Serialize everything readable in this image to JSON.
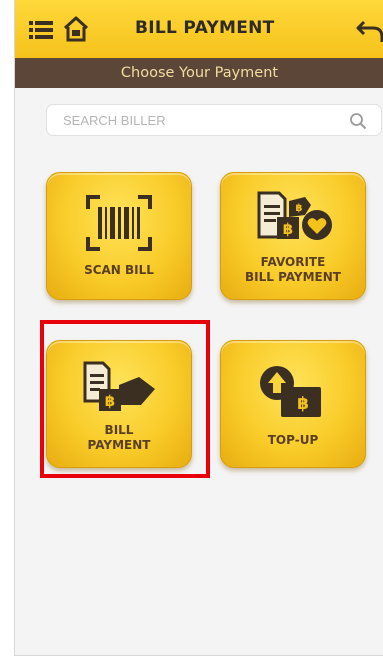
{
  "header": {
    "title": "BILL PAYMENT",
    "menu_icon": "menu-icon",
    "home_icon": "home-icon",
    "back_icon": "back-arrow-icon",
    "bg_color": "#f8c91f"
  },
  "subheader": {
    "text": "Choose Your Payment",
    "bg_color": "#5b4638",
    "text_color": "#f3dca0"
  },
  "search": {
    "placeholder": "SEARCH BILLER",
    "icon": "search-icon"
  },
  "tiles": [
    {
      "id": "scan-bill",
      "label": "SCAN BILL",
      "icon": "barcode-scan-icon"
    },
    {
      "id": "favorite-bill-payment",
      "label_line1": "FAVORITE",
      "label_line2": "BILL PAYMENT",
      "icon": "favorite-bill-icon"
    },
    {
      "id": "bill-payment",
      "label_line1": "BILL",
      "label_line2": "PAYMENT",
      "icon": "bill-payment-icon",
      "highlighted": true
    },
    {
      "id": "top-up",
      "label": "TOP-UP",
      "icon": "top-up-icon"
    }
  ],
  "colors": {
    "tile_yellow": "#f9cc2a",
    "highlight_red": "#e8000b",
    "label_brown": "#5a4020"
  }
}
